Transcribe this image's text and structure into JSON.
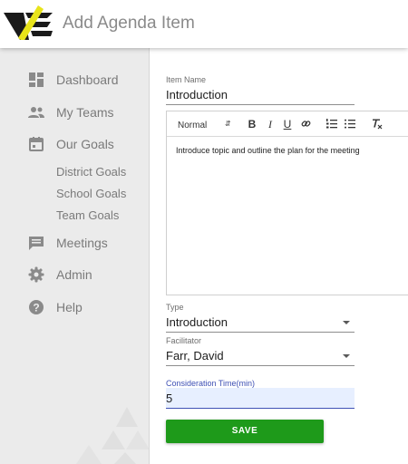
{
  "header": {
    "title": "Add Agenda Item",
    "logo": "brand-logo"
  },
  "sidebar": {
    "items": [
      {
        "label": "Dashboard",
        "icon": "dashboard-icon"
      },
      {
        "label": "My Teams",
        "icon": "teams-icon"
      },
      {
        "label": "Our Goals",
        "icon": "calendar-icon"
      },
      {
        "label": "Meetings",
        "icon": "chat-icon"
      },
      {
        "label": "Admin",
        "icon": "gear-icon"
      },
      {
        "label": "Help",
        "icon": "help-icon"
      }
    ],
    "goal_subitems": [
      "District Goals",
      "School Goals",
      "Team Goals"
    ]
  },
  "form": {
    "item_name": {
      "label": "Item Name",
      "value": "Introduction"
    },
    "editor": {
      "format": "Normal",
      "content": "Introduce topic and outline the plan for the meeting"
    },
    "type": {
      "label": "Type",
      "value": "Introduction"
    },
    "facilitator": {
      "label": "Facilitator",
      "value": "Farr, David"
    },
    "consideration_time": {
      "label": "Consideration Time(min)",
      "value": "5"
    },
    "save_label": "SAVE"
  },
  "colors": {
    "accent": "#3f51b5",
    "save": "#1e9a1a",
    "sidebar_bg": "#ebebeb",
    "focus_bg": "#e7efff"
  }
}
